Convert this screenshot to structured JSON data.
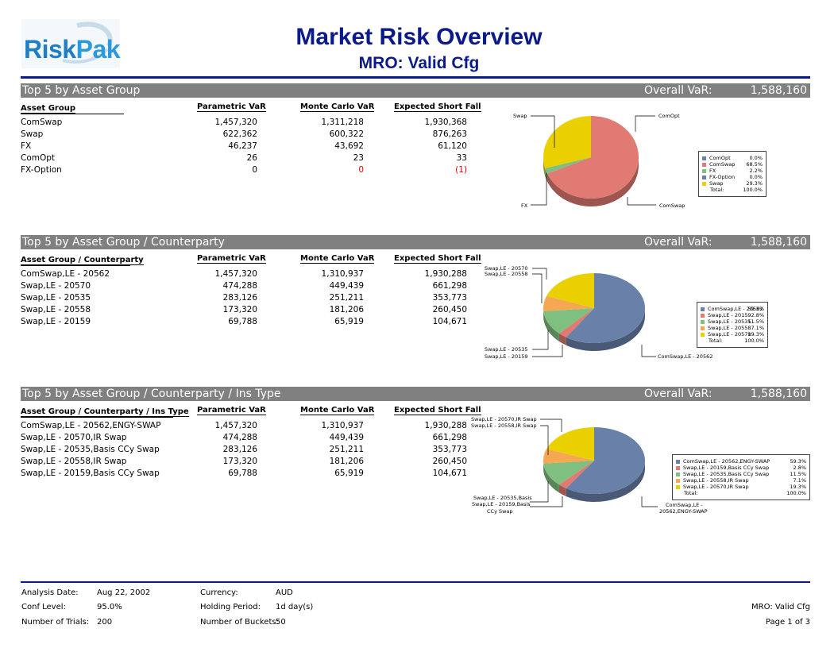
{
  "header": {
    "logo_text": "RiskPak",
    "title": "Market Risk Overview",
    "subtitle": "MRO: Valid Cfg"
  },
  "colors": {
    "title_blue": "#0b1a8a",
    "band_gray": "#808080",
    "negative_red": "#e00000",
    "pie_comswap": "#e07a72",
    "pie_swap": "#ebd000",
    "pie_fx": "#7fbf7f",
    "pie_blue": "#6980a8",
    "pie_orange": "#f5a752"
  },
  "columns": {
    "parametric": "Parametric VaR",
    "monte_carlo": "Monte Carlo VaR",
    "esf": "Expected Short Fall"
  },
  "sections": [
    {
      "band_label": "Top 5 by Asset Group",
      "overall_label": "Overall VaR:",
      "overall_value": "1,588,160",
      "first_col_header": "Asset Group",
      "rows": [
        {
          "name": "ComSwap",
          "p": "1,457,320",
          "m": "1,311,218",
          "e": "1,930,368",
          "neg_m": false,
          "neg_e": false
        },
        {
          "name": "Swap",
          "p": "622,362",
          "m": "600,322",
          "e": "876,263",
          "neg_m": false,
          "neg_e": false
        },
        {
          "name": "FX",
          "p": "46,237",
          "m": "43,692",
          "e": "61,120",
          "neg_m": false,
          "neg_e": false
        },
        {
          "name": "ComOpt",
          "p": "26",
          "m": "23",
          "e": "33",
          "neg_m": false,
          "neg_e": false
        },
        {
          "name": "FX-Option",
          "p": "0",
          "m": "0",
          "e": "(1)",
          "neg_m": true,
          "neg_e": true
        }
      ],
      "pie_labels": [
        "Swap",
        "ComOpt",
        "FX",
        "ComSwap"
      ],
      "legend": [
        {
          "label": "ComOpt",
          "pct": "0.0%"
        },
        {
          "label": "ComSwap",
          "pct": "68.5%"
        },
        {
          "label": "FX",
          "pct": "2.2%"
        },
        {
          "label": "FX-Option",
          "pct": "0.0%"
        },
        {
          "label": "Swap",
          "pct": "29.3%"
        }
      ],
      "legend_total_label": "Total:",
      "legend_total": "100.0%",
      "chart_data": {
        "type": "pie",
        "labels": [
          "ComOpt",
          "ComSwap",
          "FX",
          "FX-Option",
          "Swap"
        ],
        "values": [
          0.0,
          68.5,
          2.2,
          0.0,
          29.3
        ]
      }
    },
    {
      "band_label": "Top 5 by Asset Group / Counterparty",
      "overall_label": "Overall VaR:",
      "overall_value": "1,588,160",
      "first_col_header": "Asset Group / Counterparty",
      "rows": [
        {
          "name": "ComSwap,LE - 20562",
          "p": "1,457,320",
          "m": "1,310,937",
          "e": "1,930,288"
        },
        {
          "name": "Swap,LE - 20570",
          "p": "474,288",
          "m": "449,439",
          "e": "661,298"
        },
        {
          "name": "Swap,LE - 20535",
          "p": "283,126",
          "m": "251,211",
          "e": "353,773"
        },
        {
          "name": "Swap,LE - 20558",
          "p": "173,320",
          "m": "181,206",
          "e": "260,450"
        },
        {
          "name": "Swap,LE - 20159",
          "p": "69,788",
          "m": "65,919",
          "e": "104,671"
        }
      ],
      "pie_labels": [
        "Swap,LE - 20570",
        "Swap,LE - 20558",
        "Swap,LE - 20535",
        "Swap,LE - 20159",
        "ComSwap,LE - 20562"
      ],
      "legend": [
        {
          "label": "ComSwap,LE - 20562",
          "pct": "59.3%"
        },
        {
          "label": "Swap,LE - 20159",
          "pct": "2.8%"
        },
        {
          "label": "Swap,LE - 20535",
          "pct": "11.5%"
        },
        {
          "label": "Swap,LE - 20558",
          "pct": "7.1%"
        },
        {
          "label": "Swap,LE - 20570",
          "pct": "19.3%"
        }
      ],
      "legend_total_label": "Total:",
      "legend_total": "100.0%",
      "chart_data": {
        "type": "pie",
        "labels": [
          "ComSwap,LE - 20562",
          "Swap,LE - 20159",
          "Swap,LE - 20535",
          "Swap,LE - 20558",
          "Swap,LE - 20570"
        ],
        "values": [
          59.3,
          2.8,
          11.5,
          7.1,
          19.3
        ]
      }
    },
    {
      "band_label": "Top 5 by Asset Group / Counterparty / Ins Type",
      "overall_label": "Overall VaR:",
      "overall_value": "1,588,160",
      "first_col_header": "Asset Group / Counterparty / Ins Type",
      "rows": [
        {
          "name": "ComSwap,LE - 20562,ENGY-SWAP",
          "p": "1,457,320",
          "m": "1,310,937",
          "e": "1,930,288"
        },
        {
          "name": "Swap,LE - 20570,IR Swap",
          "p": "474,288",
          "m": "449,439",
          "e": "661,298"
        },
        {
          "name": "Swap,LE - 20535,Basis CCy Swap",
          "p": "283,126",
          "m": "251,211",
          "e": "353,773"
        },
        {
          "name": "Swap,LE - 20558,IR Swap",
          "p": "173,320",
          "m": "181,206",
          "e": "260,450"
        },
        {
          "name": "Swap,LE - 20159,Basis CCy Swap",
          "p": "69,788",
          "m": "65,919",
          "e": "104,671"
        }
      ],
      "pie_labels": [
        "Swap,LE - 20570,IR Swap",
        "Swap,LE - 20558,IR Swap",
        "Swap,LE - 20535,Basis",
        "Swap,LE - 20159,Basis",
        "CCy Swap",
        "ComSwap,LE -",
        "20562,ENGY-SWAP"
      ],
      "legend": [
        {
          "label": "ComSwap,LE - 20562,ENGY-SWAP",
          "pct": "59.3%"
        },
        {
          "label": "Swap,LE - 20159,Basis CCy Swap",
          "pct": "2.8%"
        },
        {
          "label": "Swap,LE - 20535,Basis CCy Swap",
          "pct": "11.5%"
        },
        {
          "label": "Swap,LE - 20558,IR Swap",
          "pct": "7.1%"
        },
        {
          "label": "Swap,LE - 20570,IR Swap",
          "pct": "19.3%"
        }
      ],
      "legend_total_label": "Total:",
      "legend_total": "100.0%",
      "chart_data": {
        "type": "pie",
        "labels": [
          "ComSwap,LE - 20562,ENGY-SWAP",
          "Swap,LE - 20159,Basis CCy Swap",
          "Swap,LE - 20535,Basis CCy Swap",
          "Swap,LE - 20558,IR Swap",
          "Swap,LE - 20570,IR Swap"
        ],
        "values": [
          59.3,
          2.8,
          11.5,
          7.1,
          19.3
        ]
      }
    }
  ],
  "footer": {
    "analysis_date_label": "Analysis Date:",
    "analysis_date": "Aug 22, 2002",
    "conf_level_label": "Conf Level:",
    "conf_level": "95.0%",
    "trials_label": "Number of Trials:",
    "trials": "200",
    "currency_label": "Currency:",
    "currency": "AUD",
    "holding_label": "Holding Period:",
    "holding": "1d day(s)",
    "buckets_label": "Number of Buckets:",
    "buckets": "50",
    "report_name": "MRO: Valid Cfg",
    "page": "Page 1 of 3"
  }
}
